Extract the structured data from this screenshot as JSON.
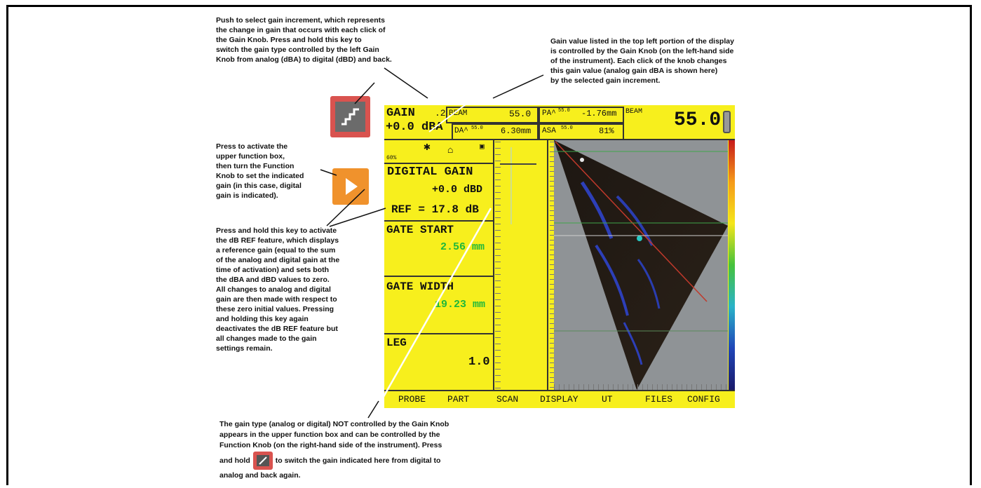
{
  "notes": {
    "increment": [
      "Push to select gain increment, which represents",
      "the change in gain that occurs with each click of",
      "the Gain Knob. Press and hold this key to",
      "switch the gain type controlled by the left Gain",
      "Knob from analog (dBA) to digital (dBD) and back."
    ],
    "gain_value": [
      "Gain value listed in the top left portion of the display",
      "is controlled by the Gain Knob (on the left-hand side",
      "of the instrument). Each click of the knob changes",
      "this gain value (analog gain dBA is shown here)",
      "by the selected gain increment."
    ],
    "function_box": [
      "Press to activate the",
      "upper function box,",
      "then turn the Function",
      "Knob to set the indicated",
      "gain (in this case, digital",
      "gain is indicated)."
    ],
    "dbref": [
      "Press and hold this key to activate",
      "the dB REF feature, which displays",
      "a reference gain (equal to the sum",
      "of the analog and digital gain at the",
      "time of activation) and sets both",
      "the dBA and dBD values to zero.",
      "All changes to analog and digital",
      "gain are then made with respect to",
      "these zero initial values. Pressing",
      "and holding this key again",
      "deactivates the dB REF feature but",
      "all changes made to the gain",
      "settings remain."
    ],
    "bottom": [
      "The gain type (analog or digital) NOT controlled by the Gain Knob",
      "appears in the upper function box and can be controlled by the",
      "Function Knob (on the right-hand side of the instrument). Press"
    ],
    "bottom_line4a": "and hold",
    "bottom_line4b": "to switch the gain indicated here from digital to",
    "bottom_line5": "analog and back again."
  },
  "screen": {
    "gain_label": "GAIN",
    "gain_inc": ".2",
    "gain_value": "+0.0 dBA",
    "beam_small_label": "BEAM",
    "beam_small_value": "55.0",
    "da_label": "DA^",
    "da_sup": "55.0",
    "da_value": "6.30mm",
    "pa_label": "PA^",
    "pa_sup": "55.0",
    "pa_value": "-1.76mm",
    "asa_label": "ASA",
    "asa_sup": "55.0",
    "asa_value": "81%",
    "beam_label": "BEAM",
    "beam_value": "55.0",
    "status_pct": "60%",
    "digital_gain_label": "DIGITAL GAIN",
    "digital_gain_value": "+0.0 dBD",
    "ref_label": "REF = 17.8 dB",
    "gate_start_label": "GATE START",
    "gate_start_value": "2.56 mm",
    "gate_width_label": "GATE WIDTH",
    "gate_width_value": "19.23 mm",
    "leg_label": "LEG",
    "leg_value": "1.0",
    "menu": [
      "PROBE",
      "PART",
      "SCAN",
      "DISPLAY",
      "UT",
      "FILES",
      "CONFIG"
    ]
  },
  "colors": {
    "screen_bg": "#f7ef1d",
    "gate_value": "#1fb83a",
    "increment_key": "#d9534f",
    "function_key": "#f0922c"
  },
  "icons": [
    "increment-key-icon",
    "function-key-icon",
    "increment-key-small-icon"
  ]
}
